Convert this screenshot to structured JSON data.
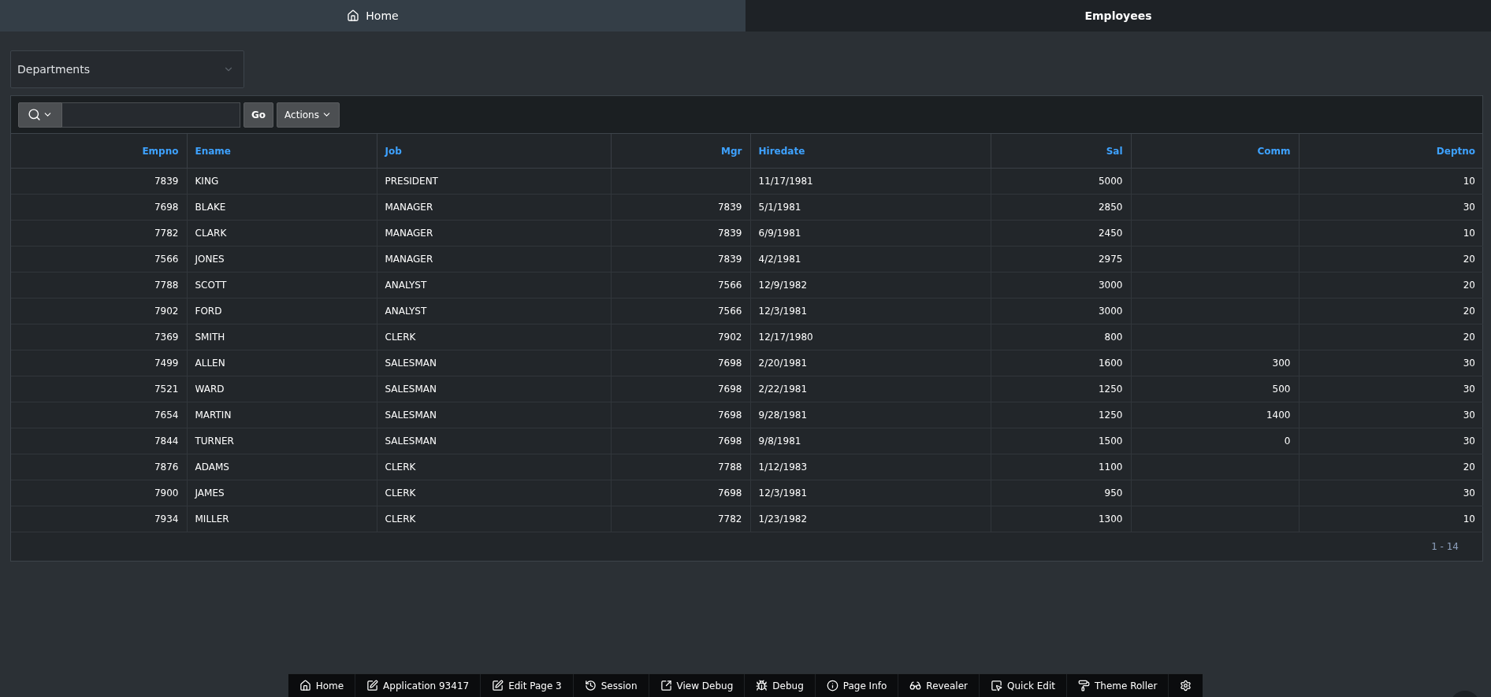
{
  "tabs": [
    {
      "label": "Home",
      "selected": false
    },
    {
      "label": "Employees",
      "selected": true
    }
  ],
  "filter": {
    "value": "Departments"
  },
  "toolbar": {
    "go": "Go",
    "actions": "Actions"
  },
  "table": {
    "columns": [
      "Empno",
      "Ename",
      "Job",
      "Mgr",
      "Hiredate",
      "Sal",
      "Comm",
      "Deptno"
    ],
    "rows": [
      [
        "7839",
        "KING",
        "PRESIDENT",
        null,
        "11/17/1981",
        "5000",
        null,
        "10"
      ],
      [
        "7698",
        "BLAKE",
        "MANAGER",
        "7839",
        "5/1/1981",
        "2850",
        null,
        "30"
      ],
      [
        "7782",
        "CLARK",
        "MANAGER",
        "7839",
        "6/9/1981",
        "2450",
        null,
        "10"
      ],
      [
        "7566",
        "JONES",
        "MANAGER",
        "7839",
        "4/2/1981",
        "2975",
        null,
        "20"
      ],
      [
        "7788",
        "SCOTT",
        "ANALYST",
        "7566",
        "12/9/1982",
        "3000",
        null,
        "20"
      ],
      [
        "7902",
        "FORD",
        "ANALYST",
        "7566",
        "12/3/1981",
        "3000",
        null,
        "20"
      ],
      [
        "7369",
        "SMITH",
        "CLERK",
        "7902",
        "12/17/1980",
        "800",
        null,
        "20"
      ],
      [
        "7499",
        "ALLEN",
        "SALESMAN",
        "7698",
        "2/20/1981",
        "1600",
        "300",
        "30"
      ],
      [
        "7521",
        "WARD",
        "SALESMAN",
        "7698",
        "2/22/1981",
        "1250",
        "500",
        "30"
      ],
      [
        "7654",
        "MARTIN",
        "SALESMAN",
        "7698",
        "9/28/1981",
        "1250",
        "1400",
        "30"
      ],
      [
        "7844",
        "TURNER",
        "SALESMAN",
        "7698",
        "9/8/1981",
        "1500",
        "0",
        "30"
      ],
      [
        "7876",
        "ADAMS",
        "CLERK",
        "7788",
        "1/12/1983",
        "1100",
        null,
        "20"
      ],
      [
        "7900",
        "JAMES",
        "CLERK",
        "7698",
        "12/3/1981",
        "950",
        null,
        "30"
      ],
      [
        "7934",
        "MILLER",
        "CLERK",
        "7782",
        "1/23/1982",
        "1300",
        null,
        "10"
      ]
    ],
    "pagination": "1 - 14"
  },
  "dev_toolbar": [
    "Home",
    "Application 93417",
    "Edit Page 3",
    "Session",
    "View Debug",
    "Debug",
    "Page Info",
    "Revealer",
    "Quick Edit",
    "Theme Roller"
  ]
}
